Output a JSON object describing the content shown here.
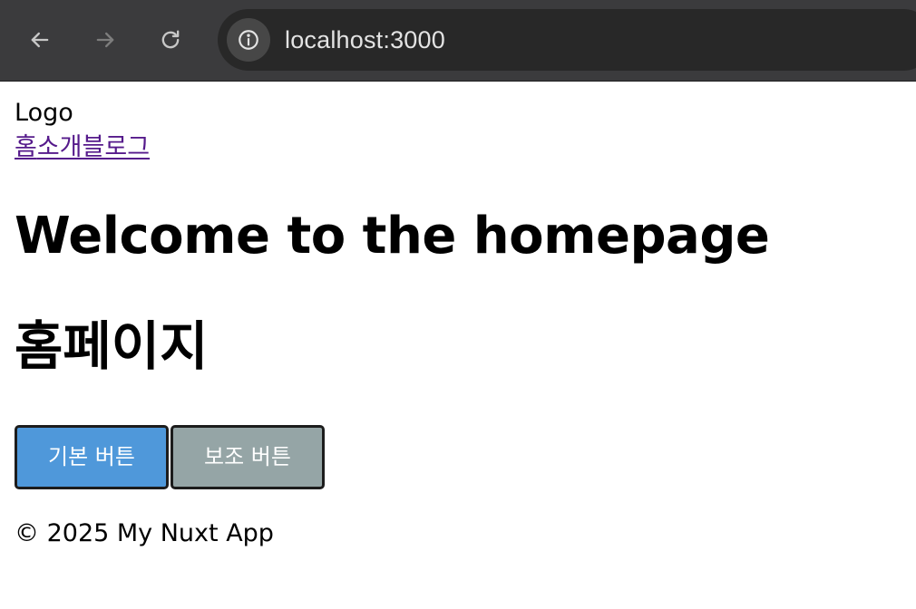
{
  "browser": {
    "url": "localhost:3000",
    "icons": {
      "back": "arrow-left-icon",
      "forward": "arrow-right-icon",
      "reload": "reload-icon",
      "site_info": "info-icon"
    }
  },
  "header": {
    "logo": "Logo",
    "nav": [
      "홈",
      "소개",
      "블로그"
    ]
  },
  "main": {
    "title": "Welcome to the homepage",
    "subtitle": "홈페이지",
    "buttons": {
      "primary": "기본 버튼",
      "secondary": "보조 버튼"
    }
  },
  "footer": {
    "text": "© 2025 My Nuxt App"
  },
  "colors": {
    "chrome_bg": "#3b3b3d",
    "address_bg": "#282828",
    "link_visited": "#551a8b",
    "primary_button": "#4f98da",
    "secondary_button": "#95a5a6"
  }
}
